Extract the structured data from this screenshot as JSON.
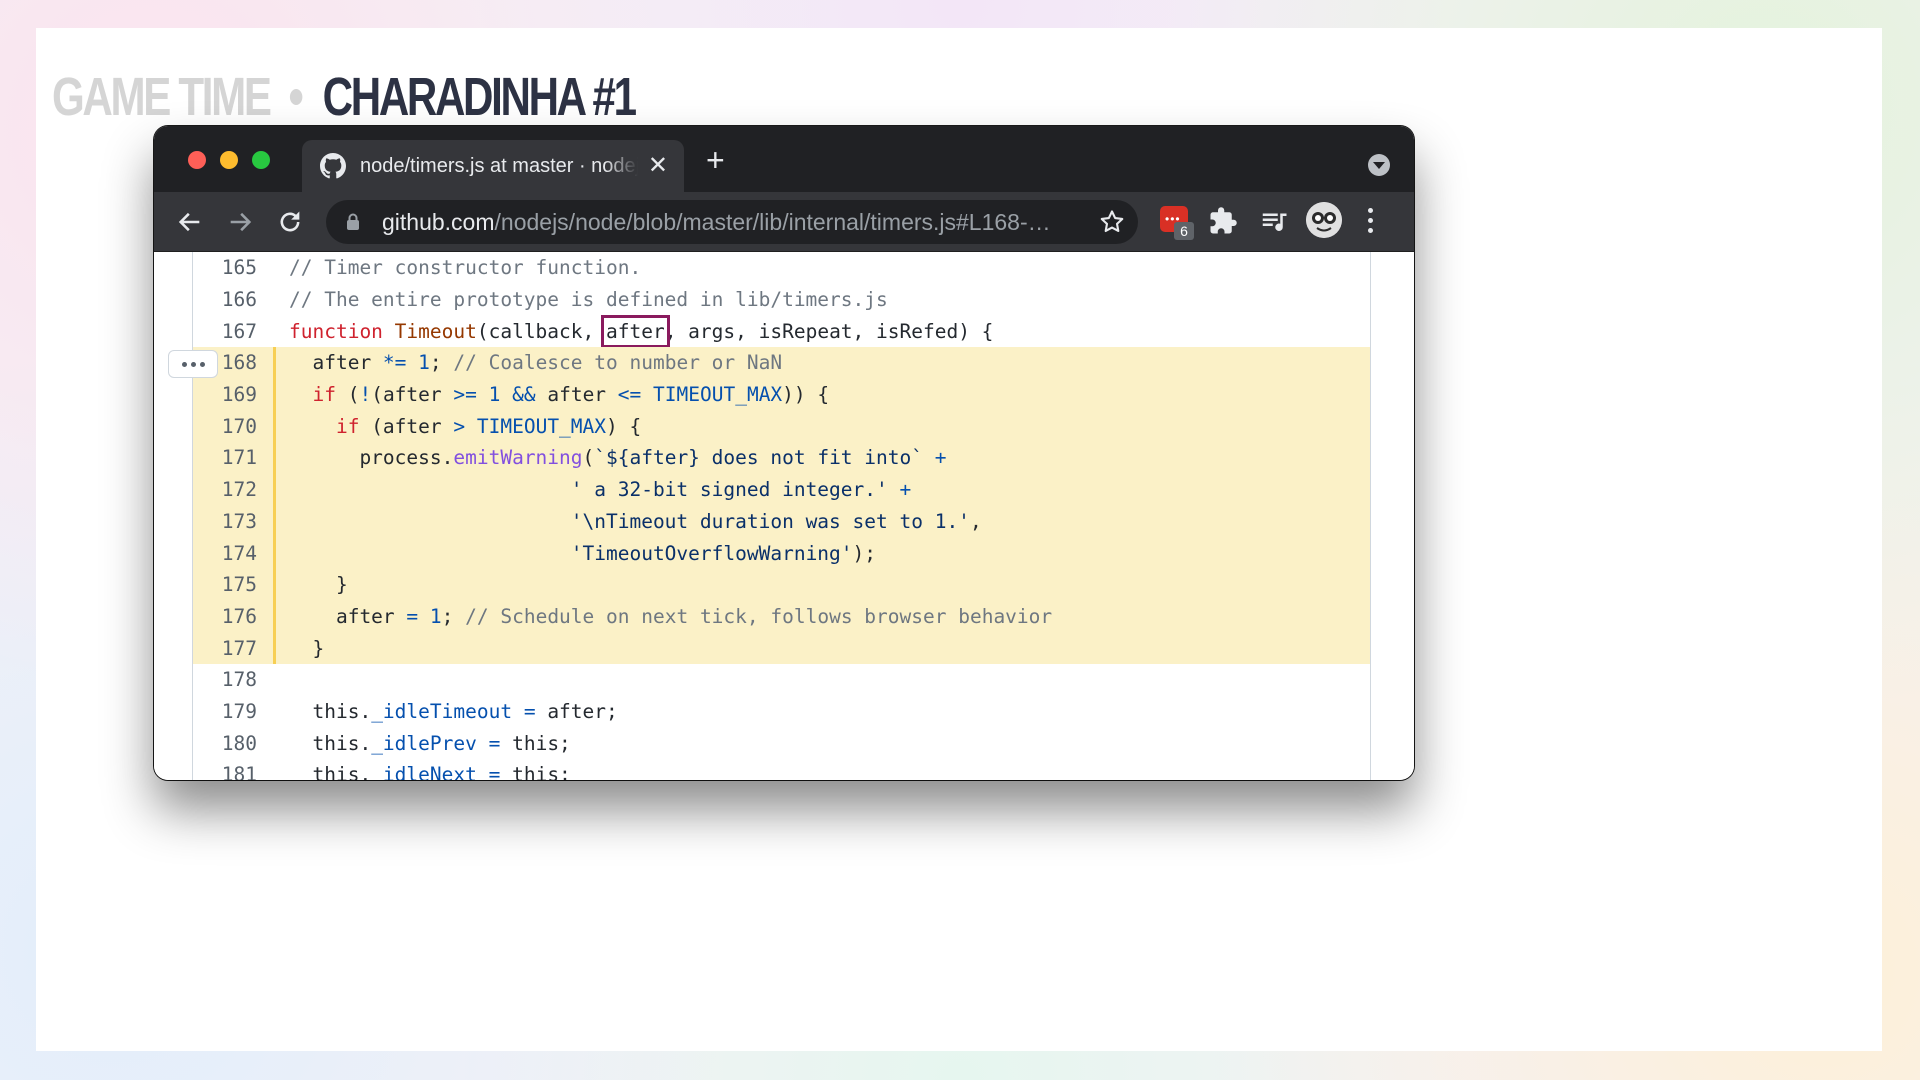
{
  "slide": {
    "kicker": "GAME TIME",
    "title": "CHARADINHA #1"
  },
  "browser": {
    "tab_title": "node/timers.js at master · nodejs/node",
    "close_glyph": "✕",
    "new_tab_glyph": "+",
    "url_host": "github.com",
    "url_path": "/nodejs/node/blob/master/lib/internal/timers.js#L168-…",
    "extension_badge": "6"
  },
  "colors": {
    "highlight_bg": "#fbf1c7",
    "highlight_bar": "#f7cf54",
    "selection_box": "#8a1a5e"
  },
  "code": {
    "lines": [
      {
        "n": "165",
        "hl": false,
        "tokens": [
          [
            "c",
            "// Timer constructor function."
          ]
        ]
      },
      {
        "n": "166",
        "hl": false,
        "tokens": [
          [
            "c",
            "// The entire prototype is defined in lib/timers.js"
          ]
        ]
      },
      {
        "n": "167",
        "hl": false,
        "tokens": [
          [
            "k",
            "function "
          ],
          [
            "e",
            "Timeout"
          ],
          [
            "",
            "(callback, "
          ],
          [
            "box",
            "after"
          ],
          [
            "",
            ", args, isRepeat, isRefed) {"
          ]
        ]
      },
      {
        "n": "168",
        "hl": true,
        "tokens": [
          [
            "",
            "  after "
          ],
          [
            "o",
            "*="
          ],
          [
            "",
            " "
          ],
          [
            "o",
            "1"
          ],
          [
            "",
            "; "
          ],
          [
            "c",
            "// Coalesce to number or NaN"
          ]
        ]
      },
      {
        "n": "169",
        "hl": true,
        "tokens": [
          [
            "",
            "  "
          ],
          [
            "k",
            "if"
          ],
          [
            "",
            " ("
          ],
          [
            "o",
            "!"
          ],
          [
            "",
            "(after "
          ],
          [
            "o",
            ">="
          ],
          [
            "",
            " "
          ],
          [
            "o",
            "1"
          ],
          [
            "",
            " "
          ],
          [
            "o",
            "&&"
          ],
          [
            "",
            " after "
          ],
          [
            "o",
            "<="
          ],
          [
            "",
            " "
          ],
          [
            "o",
            "TIMEOUT_MAX"
          ],
          [
            "",
            ")) {"
          ]
        ]
      },
      {
        "n": "170",
        "hl": true,
        "tokens": [
          [
            "",
            "    "
          ],
          [
            "k",
            "if"
          ],
          [
            "",
            " (after "
          ],
          [
            "o",
            ">"
          ],
          [
            "",
            " "
          ],
          [
            "o",
            "TIMEOUT_MAX"
          ],
          [
            "",
            ") {"
          ]
        ]
      },
      {
        "n": "171",
        "hl": true,
        "tokens": [
          [
            "",
            "      process."
          ],
          [
            "f",
            "emitWarning"
          ],
          [
            "",
            "("
          ],
          [
            "s",
            "`${after} does not fit into`"
          ],
          [
            "",
            " "
          ],
          [
            "o",
            "+"
          ]
        ]
      },
      {
        "n": "172",
        "hl": true,
        "tokens": [
          [
            "",
            "                        "
          ],
          [
            "s",
            "' a 32-bit signed integer.'"
          ],
          [
            "",
            " "
          ],
          [
            "o",
            "+"
          ]
        ]
      },
      {
        "n": "173",
        "hl": true,
        "tokens": [
          [
            "",
            "                        "
          ],
          [
            "s",
            "'\\nTimeout duration was set to 1.'"
          ],
          [
            "",
            ","
          ]
        ]
      },
      {
        "n": "174",
        "hl": true,
        "tokens": [
          [
            "",
            "                        "
          ],
          [
            "s",
            "'TimeoutOverflowWarning'"
          ],
          [
            "",
            ");"
          ]
        ]
      },
      {
        "n": "175",
        "hl": true,
        "tokens": [
          [
            "",
            "    }"
          ]
        ]
      },
      {
        "n": "176",
        "hl": true,
        "tokens": [
          [
            "",
            "    after "
          ],
          [
            "o",
            "="
          ],
          [
            "",
            " "
          ],
          [
            "o",
            "1"
          ],
          [
            "",
            "; "
          ],
          [
            "c",
            "// Schedule on next tick, follows browser behavior"
          ]
        ]
      },
      {
        "n": "177",
        "hl": true,
        "tokens": [
          [
            "",
            "  }"
          ]
        ]
      },
      {
        "n": "178",
        "hl": false,
        "tokens": [
          [
            "",
            ""
          ]
        ]
      },
      {
        "n": "179",
        "hl": false,
        "tokens": [
          [
            "",
            "  this."
          ],
          [
            "o",
            "_idleTimeout"
          ],
          [
            "",
            " "
          ],
          [
            "o",
            "="
          ],
          [
            "",
            " after;"
          ]
        ]
      },
      {
        "n": "180",
        "hl": false,
        "tokens": [
          [
            "",
            "  this."
          ],
          [
            "o",
            "_idlePrev"
          ],
          [
            "",
            " "
          ],
          [
            "o",
            "="
          ],
          [
            "",
            " this;"
          ]
        ]
      },
      {
        "n": "181",
        "hl": false,
        "tokens": [
          [
            "",
            "  this."
          ],
          [
            "o",
            "_idleNext"
          ],
          [
            "",
            " "
          ],
          [
            "o",
            "="
          ],
          [
            "",
            " this;"
          ]
        ]
      }
    ]
  }
}
